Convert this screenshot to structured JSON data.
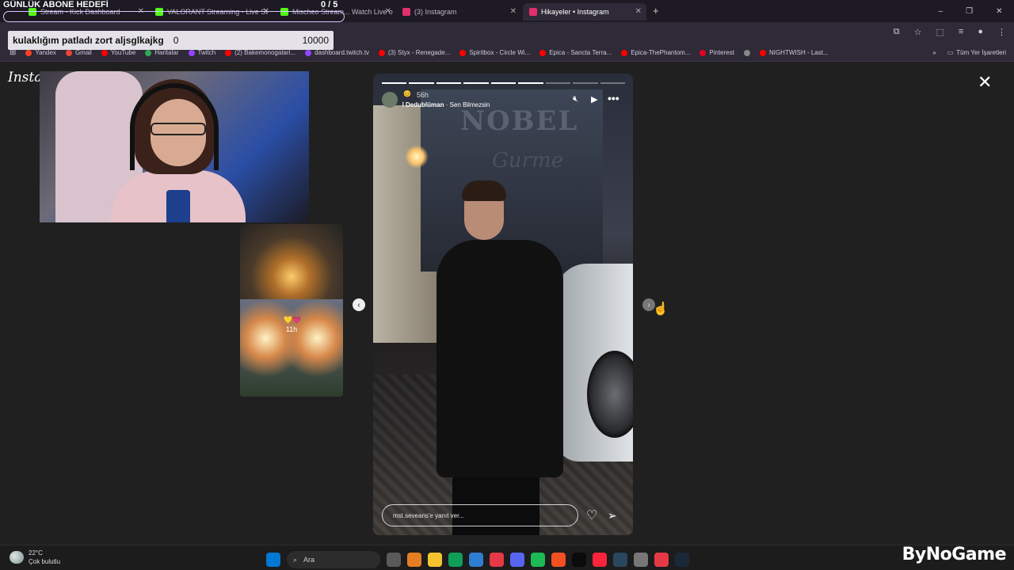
{
  "stream_overlay": {
    "goal_title": "GÜNLÜK ABONE HEDEFİ",
    "goal_count": "0 / 5",
    "sub_label": "kulaklığım patladı zort aljsglkajkg",
    "sub_current": "0",
    "sub_target": "10000"
  },
  "browser": {
    "tabs": [
      {
        "label": "Stream - Kick Dashboard",
        "color": "#53fc18"
      },
      {
        "label": "VALORANT Streaming - Live St",
        "color": "#53fc18"
      },
      {
        "label": "Mischeo Stream... Watch Live o",
        "color": "#53fc18"
      },
      {
        "label": "(3) Instagram",
        "color": "#e1306c"
      },
      {
        "label": "Hikayeler • Instagram",
        "color": "#e1306c"
      }
    ],
    "new_tab": "+",
    "window_controls": {
      "minimize": "–",
      "restore": "❐",
      "close": "✕"
    },
    "bookmarks": [
      {
        "label": "Yandex",
        "color": "#fc3f1d"
      },
      {
        "label": "Gmail",
        "color": "#ea4335"
      },
      {
        "label": "YouTube",
        "color": "#ff0000"
      },
      {
        "label": "Haritalar",
        "color": "#34a853"
      },
      {
        "label": "Twitch",
        "color": "#9146ff"
      },
      {
        "label": "(2) Bakemonogatari...",
        "color": "#ff0000"
      },
      {
        "label": "dashboard.twitch.tv",
        "color": "#9146ff"
      },
      {
        "label": "(3) Styx - Renegade...",
        "color": "#ff0000"
      },
      {
        "label": "Spiritbox - Circle Wi...",
        "color": "#ff0000"
      },
      {
        "label": "Epica - Sancta Terra...",
        "color": "#ff0000"
      },
      {
        "label": "Epica-ThePhantom...",
        "color": "#ff0000"
      },
      {
        "label": "Pinterest",
        "color": "#e60023"
      },
      {
        "label": "",
        "color": "#888888"
      },
      {
        "label": "NIGHTWISH - Last...",
        "color": "#ff0000"
      }
    ],
    "bookmarks_more": "»",
    "all_bookmarks": "Tüm Yer İşaretleri"
  },
  "instagram": {
    "logo": "Instagram",
    "side_preview": {
      "time": "11h",
      "hearts": "💛💗"
    },
    "story": {
      "time": "56h",
      "emoji": "😊",
      "music_artist": "Dedublüman",
      "music_song": "Sen Bilmezsin",
      "progress_total": 9,
      "progress_done": 6,
      "reply_placeholder": "mst.seveans'e yanıt ver..."
    },
    "close": "✕"
  },
  "taskbar": {
    "temperature": "22°C",
    "weather": "Çok bulutlu",
    "search_label": "Ara",
    "icon_colors": [
      "#0078d4",
      "#5a5a5a",
      "#e67e22",
      "#f4c430",
      "#0f9d58",
      "#2f7dd1",
      "#e63946",
      "#5865f2",
      "#1db954",
      "#f25022",
      "#0b0b0b",
      "#fa243c",
      "#2a475e",
      "#777777",
      "#e63946",
      "#1b2838"
    ]
  },
  "watermark": "ByNoGame"
}
